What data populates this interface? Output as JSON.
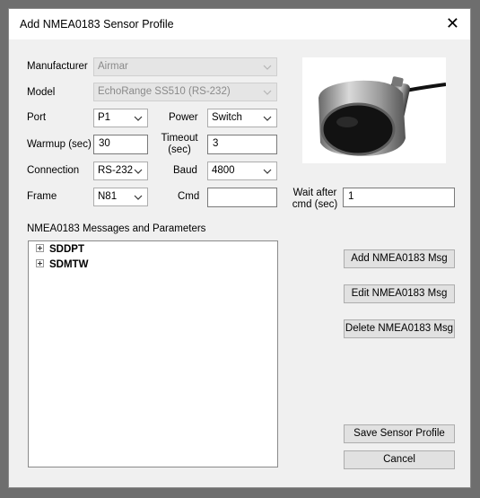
{
  "dialog": {
    "title": "Add NMEA0183 Sensor Profile",
    "close_icon": "close-icon"
  },
  "form": {
    "manufacturer": {
      "label": "Manufacturer",
      "value": "Airmar"
    },
    "model": {
      "label": "Model",
      "value": "EchoRange SS510 (RS-232)"
    },
    "port": {
      "label": "Port",
      "value": "P1"
    },
    "power": {
      "label": "Power",
      "value": "Switch"
    },
    "warmup": {
      "label": "Warmup (sec)",
      "value": "30"
    },
    "timeout": {
      "label_line1": "Timeout",
      "label_line2": "(sec)",
      "value": "3"
    },
    "connection": {
      "label": "Connection",
      "value": "RS-232"
    },
    "baud": {
      "label": "Baud",
      "value": "4800"
    },
    "frame": {
      "label": "Frame",
      "value": "N81"
    },
    "cmd": {
      "label": "Cmd",
      "value": ""
    },
    "wait_after_cmd": {
      "label_line1": "Wait after",
      "label_line2": "cmd (sec)",
      "value": "1"
    }
  },
  "messages": {
    "label": "NMEA0183 Messages and Parameters",
    "items": [
      "SDDPT",
      "SDMTW"
    ]
  },
  "buttons": {
    "add": "Add NMEA0183 Msg",
    "edit": "Edit NMEA0183 Msg",
    "delete": "Delete NMEA0183 Msg",
    "save": "Save Sensor Profile",
    "cancel": "Cancel"
  },
  "image": {
    "subject": "sensor-transducer-photo"
  }
}
